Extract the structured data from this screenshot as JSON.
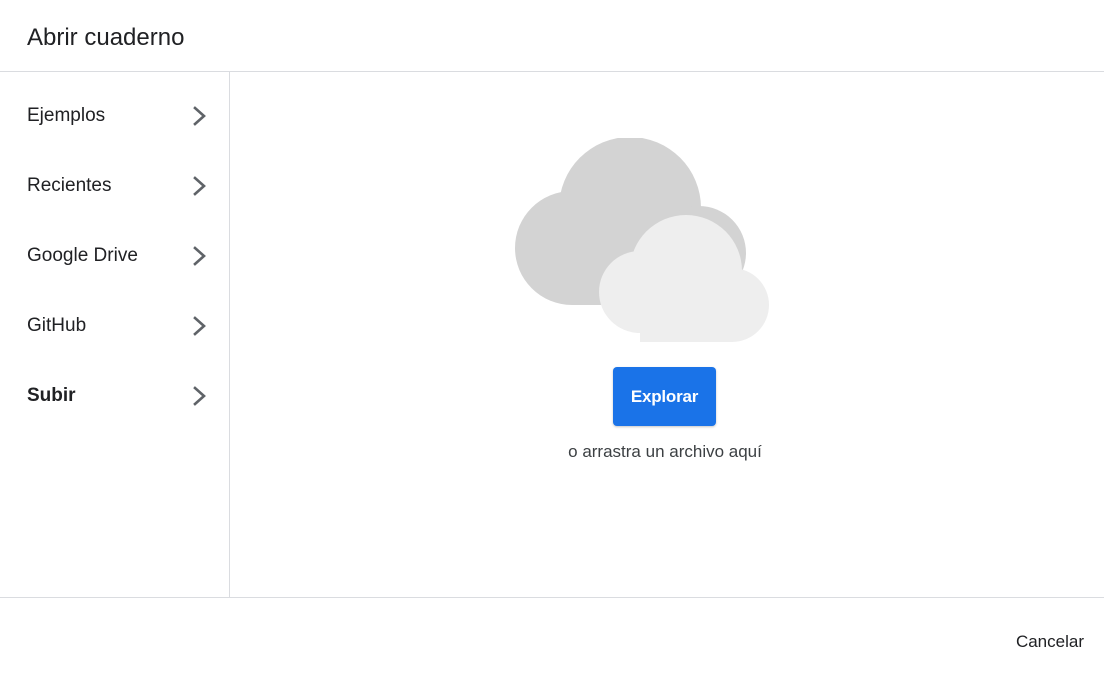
{
  "dialog": {
    "title": "Abrir cuaderno"
  },
  "sidebar": {
    "items": [
      {
        "label": "Ejemplos",
        "icon": "chevron-right-icon",
        "active": false
      },
      {
        "label": "Recientes",
        "icon": "chevron-right-icon",
        "active": false
      },
      {
        "label": "Google Drive",
        "icon": "chevron-right-icon",
        "active": false
      },
      {
        "label": "GitHub",
        "icon": "chevron-right-icon",
        "active": false
      },
      {
        "label": "Subir",
        "icon": "chevron-right-icon",
        "active": true
      }
    ]
  },
  "upload": {
    "illustration": "cloud-upload-illustration",
    "browse_label": "Explorar",
    "drop_hint": "o arrastra un archivo aquí"
  },
  "footer": {
    "cancel_label": "Cancelar"
  },
  "colors": {
    "accent": "#1a73e8",
    "divider": "#dadce0",
    "cloud_back": "#d3d3d3",
    "cloud_front": "#eeeeee"
  }
}
